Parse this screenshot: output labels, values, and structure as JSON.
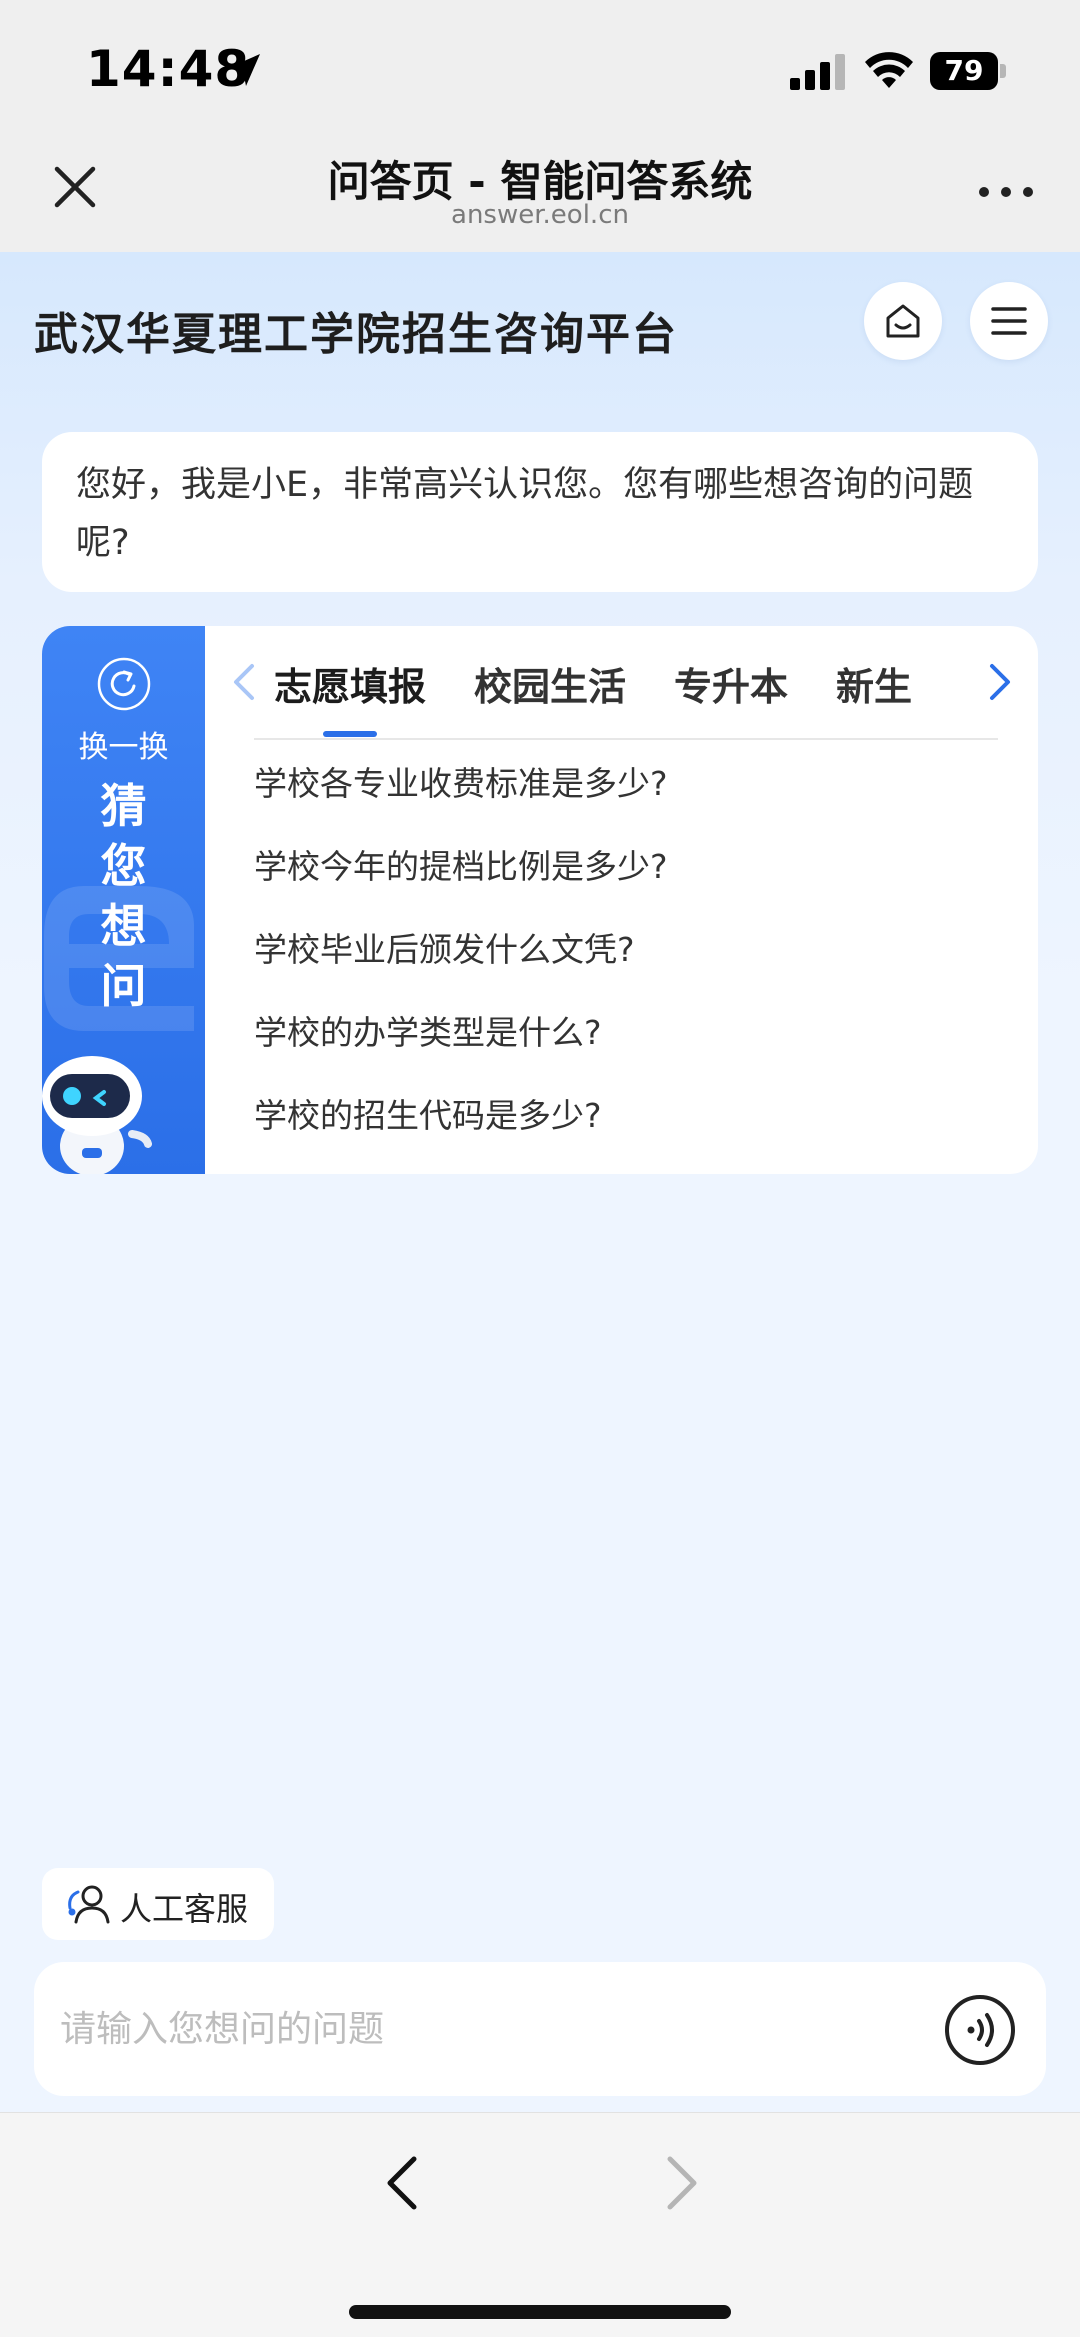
{
  "status_bar": {
    "time": "14:48",
    "battery": "79",
    "icons": [
      "location-arrow-icon",
      "signal-icon",
      "wifi-icon",
      "battery-icon"
    ]
  },
  "browser": {
    "title": "问答页 - 智能问答系统",
    "url": "answer.eol.cn",
    "close_icon": "close-icon",
    "more_icon": "more-icon"
  },
  "header": {
    "title": "武汉华夏理工学院招生咨询平台",
    "home_icon": "home-icon",
    "menu_icon": "menu-icon"
  },
  "greeting": {
    "text": "您好，我是小E，非常高兴认识您。您有哪些想咨询的问题呢?"
  },
  "suggestions": {
    "refresh_label": "换一换",
    "side_title": "猜您想问",
    "tabs": [
      {
        "label": "志愿填报",
        "active": true
      },
      {
        "label": "校园生活",
        "active": false
      },
      {
        "label": "专升本",
        "active": false
      },
      {
        "label": "新生",
        "active": false
      }
    ],
    "questions": [
      "学校各专业收费标准是多少?",
      "学校今年的提档比例是多少?",
      "学校毕业后颁发什么文凭?",
      "学校的办学类型是什么?",
      "学校的招生代码是多少?"
    ]
  },
  "human_service": {
    "label": "人工客服"
  },
  "input": {
    "placeholder": "请输入您想问的问题",
    "voice_icon": "voice-icon"
  },
  "colors": {
    "accent": "#2b6fe8",
    "background": "#eef5ff",
    "text": "#333333"
  }
}
